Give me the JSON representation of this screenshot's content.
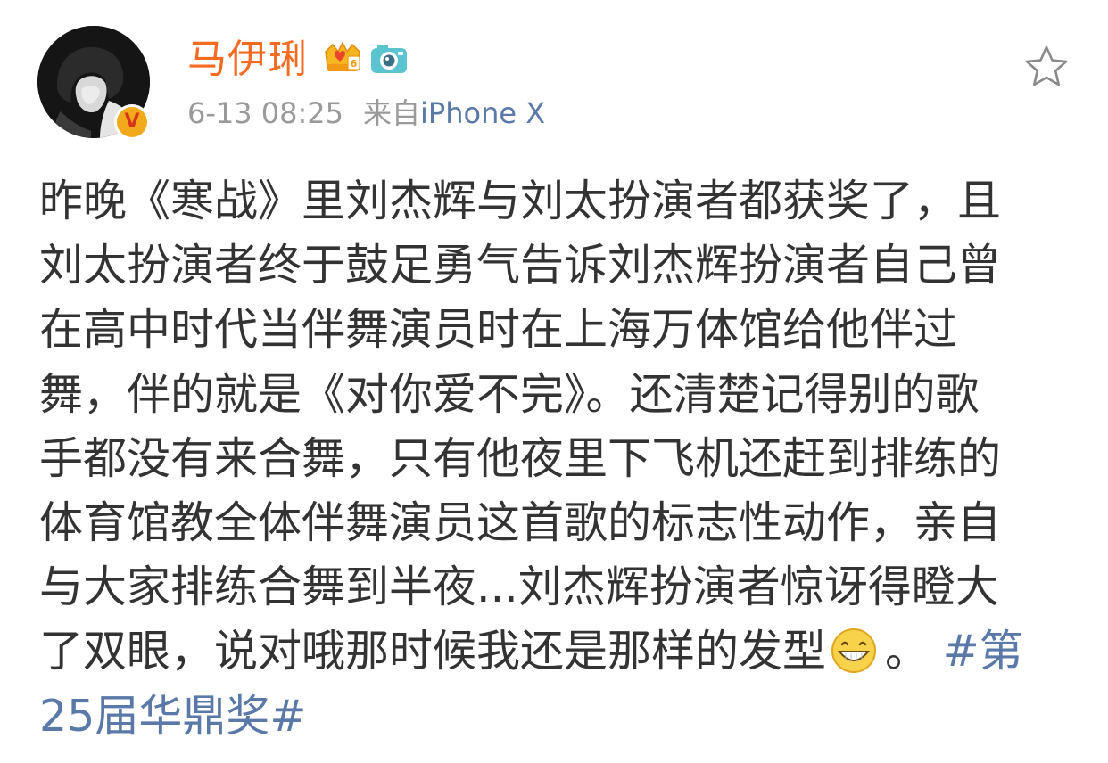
{
  "author": {
    "name": "马伊琍",
    "verified_badge": "V",
    "badges": [
      "crown-vip-icon",
      "camera-icon"
    ]
  },
  "meta": {
    "time": "6-13 08:25",
    "source_prefix": "来自",
    "source": "iPhone X"
  },
  "post": {
    "lines": [
      "昨晚《寒战》里刘杰辉与刘太扮演者都获奖了，且",
      "刘太扮演者终于鼓足勇气告诉刘杰辉扮演者自己曾",
      "在高中时代当伴舞演员时在上海万体馆给他伴过",
      "舞，伴的就是《对你爱不完》。还清楚记得别的歌",
      "手都没有来合舞，只有他夜里下飞机还赶到排练的",
      "体育馆教全体伴舞演员这首歌的标志性动作，亲自",
      "与大家排练合舞到半夜...刘杰辉扮演者惊讶得瞪大"
    ],
    "line8_text": "了双眼，说对哦那时候我还是那样的发型",
    "line8_after_emoji": "。",
    "hashtag_part1": "#第",
    "hashtag_part2": "25届华鼎奖#"
  },
  "colors": {
    "username": "#f56b21",
    "link": "#5a78a8",
    "meta": "#9a9a9a",
    "text": "#333333"
  },
  "icons": {
    "favorite": "star-outline-icon",
    "emoji": "grin-emoji-icon"
  }
}
